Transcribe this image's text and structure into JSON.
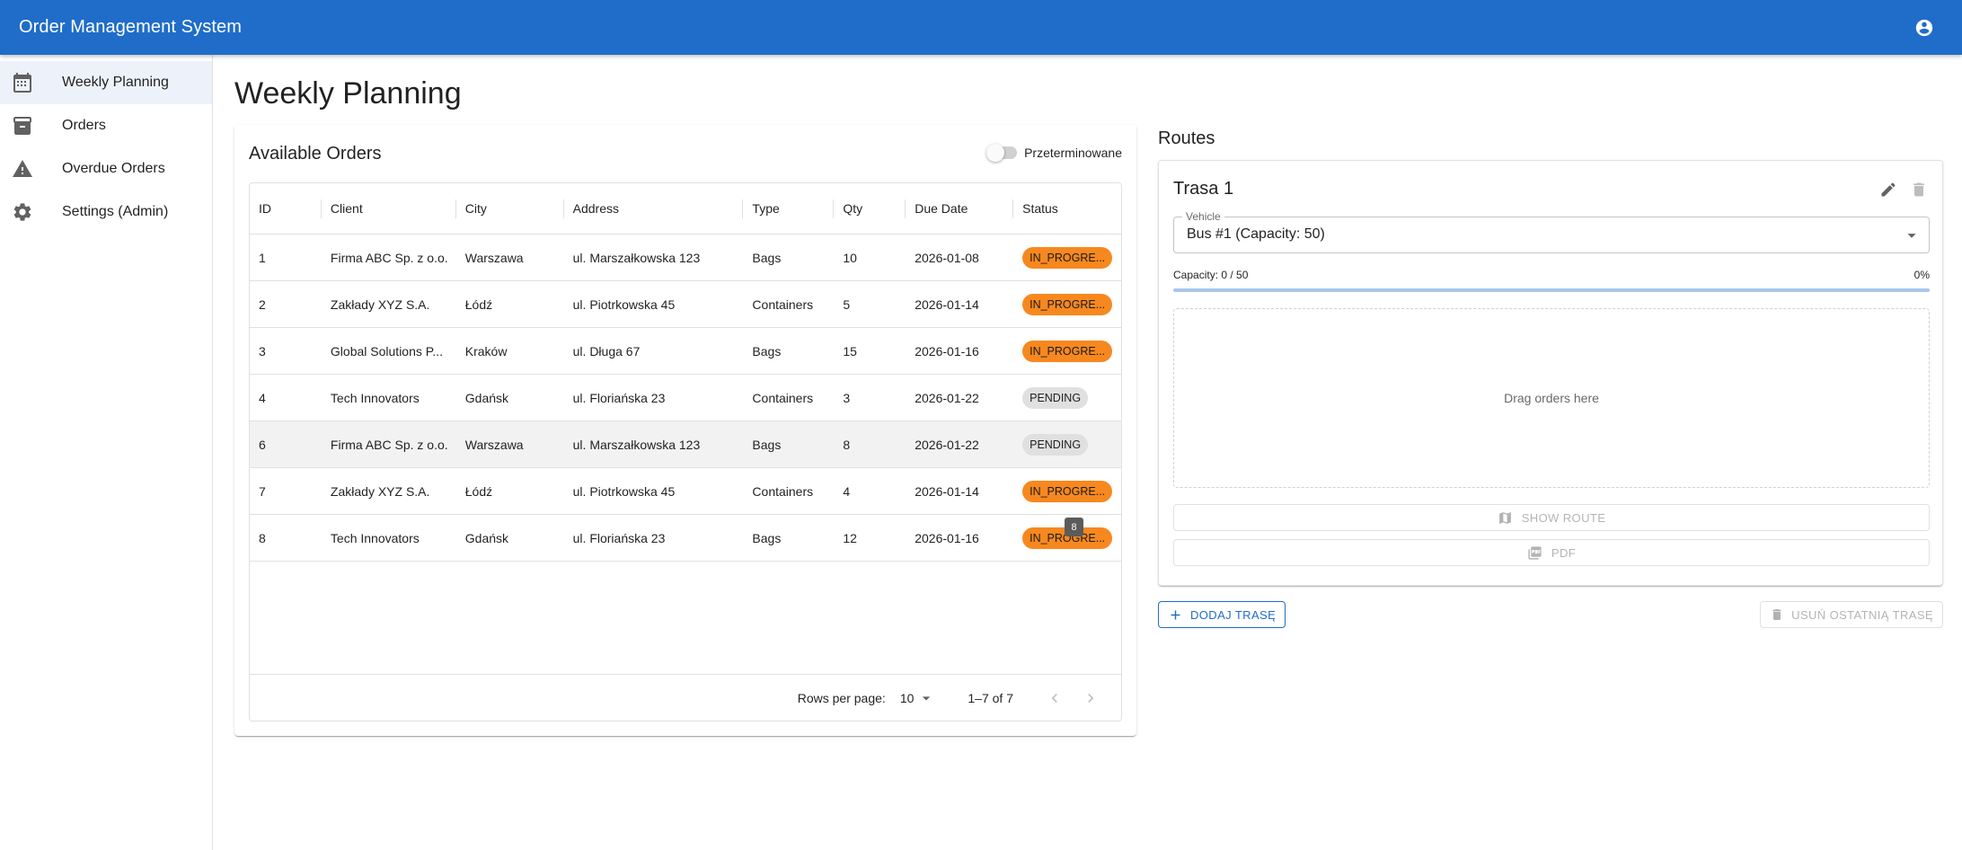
{
  "app": {
    "title": "Order Management System",
    "account_icon": "account-circle-icon"
  },
  "sidebar": {
    "items": [
      {
        "label": "Weekly Planning",
        "icon": "calendar-icon",
        "active": true
      },
      {
        "label": "Orders",
        "icon": "archive-icon",
        "active": false
      },
      {
        "label": "Overdue Orders",
        "icon": "warning-icon",
        "active": false
      },
      {
        "label": "Settings (Admin)",
        "icon": "gear-icon",
        "active": false
      }
    ]
  },
  "page": {
    "title": "Weekly Planning"
  },
  "orders": {
    "title": "Available Orders",
    "toggle_label": "Przeterminowane",
    "toggle_on": false,
    "columns": [
      "ID",
      "Client",
      "City",
      "Address",
      "Type",
      "Qty",
      "Due Date",
      "Status"
    ],
    "rows": [
      {
        "id": "1",
        "client": "Firma ABC Sp. z o.o.",
        "city": "Warszawa",
        "address": "ul. Marszałkowska 123",
        "type": "Bags",
        "qty": "10",
        "due": "2026-01-08",
        "status": "IN_PROGRE...",
        "status_color": "#f7881f"
      },
      {
        "id": "2",
        "client": "Zakłady XYZ S.A.",
        "city": "Łódź",
        "address": "ul. Piotrkowska 45",
        "type": "Containers",
        "qty": "5",
        "due": "2026-01-14",
        "status": "IN_PROGRE...",
        "status_color": "#f7881f"
      },
      {
        "id": "3",
        "client": "Global Solutions P...",
        "city": "Kraków",
        "address": "ul. Długa 67",
        "type": "Bags",
        "qty": "15",
        "due": "2026-01-16",
        "status": "IN_PROGRE...",
        "status_color": "#f7881f"
      },
      {
        "id": "4",
        "client": "Tech Innovators",
        "city": "Gdańsk",
        "address": "ul. Floriańska 23",
        "type": "Containers",
        "qty": "3",
        "due": "2026-01-22",
        "status": "PENDING",
        "status_color": "#e0e0e0"
      },
      {
        "id": "6",
        "client": "Firma ABC Sp. z o.o.",
        "city": "Warszawa",
        "address": "ul. Marszałkowska 123",
        "type": "Bags",
        "qty": "8",
        "due": "2026-01-22",
        "status": "PENDING",
        "status_color": "#e0e0e0"
      },
      {
        "id": "7",
        "client": "Zakłady XYZ S.A.",
        "city": "Łódź",
        "address": "ul. Piotrkowska 45",
        "type": "Containers",
        "qty": "4",
        "due": "2026-01-14",
        "status": "IN_PROGRE...",
        "status_color": "#f7881f"
      },
      {
        "id": "8",
        "client": "Tech Innovators",
        "city": "Gdańsk",
        "address": "ul. Floriańska 23",
        "type": "Bags",
        "qty": "12",
        "due": "2026-01-16",
        "status": "IN_PROGRE...",
        "status_color": "#f7881f"
      }
    ],
    "tooltip": "8",
    "pagination": {
      "rows_per_page_label": "Rows per page:",
      "rows_per_page": "10",
      "range": "1–7 of 7"
    }
  },
  "routes": {
    "title": "Routes",
    "route": {
      "name": "Trasa 1",
      "vehicle_label": "Vehicle",
      "vehicle_value": "Bus #1 (Capacity: 50)",
      "capacity_text": "Capacity: 0 / 50",
      "capacity_percent": "0%",
      "capacity_fraction": 0,
      "dropzone_text": "Drag orders here",
      "show_route_label": "SHOW ROUTE",
      "pdf_label": "PDF"
    },
    "add_label": "DODAJ TRASĘ",
    "remove_label": "USUŃ OSTATNIĄ TRASĘ"
  },
  "colors": {
    "primary": "#1f6dc8",
    "in_progress": "#f7881f",
    "pending": "#e0e0e0"
  }
}
